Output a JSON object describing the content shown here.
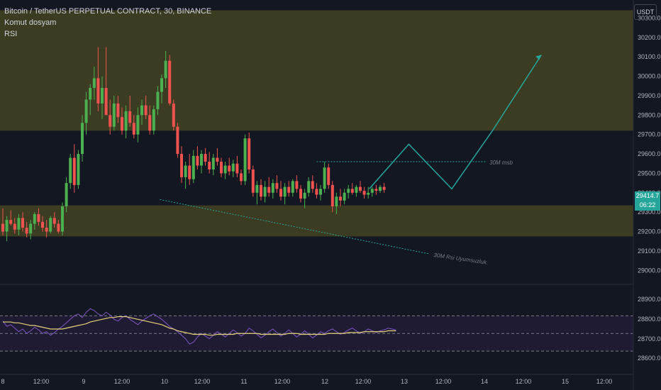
{
  "header": {
    "title": "Bitcoin / TetherUS PERPETUAL CONTRACT, 30, BINANCE",
    "indicator_1": "Komut dosyam",
    "indicator_2": "RSI",
    "currency": "USDT"
  },
  "last_price": {
    "price": "29414.7",
    "countdown": "06:22"
  },
  "annotations": {
    "msb_label": "30M msb",
    "divergence_label": "30M Rsi Uyumsuzluk."
  },
  "colors": {
    "up": "#4caf50",
    "down": "#ef5350",
    "zone_fill": "#3b3c22",
    "rsi_band": "#1e1b33",
    "rsi_line": "#7e57c2",
    "rsi_ma": "#e6d27a",
    "projection": "#26a69a",
    "price_badge": "#26a69a"
  },
  "chart_data": {
    "type": "candlestick",
    "price_axis": {
      "ticks": [
        "30300.0",
        "30200.0",
        "30100.0",
        "30000.0",
        "29900.0",
        "29800.0",
        "29700.0",
        "29600.0",
        "29500.0",
        "29400.0",
        "29300.0",
        "29200.0",
        "29100.0",
        "29000.0",
        "28900.0",
        "28800.0",
        "28700.0",
        "28600.0"
      ],
      "range": [
        28550,
        30340
      ]
    },
    "time_axis": {
      "ticks": [
        "8",
        "12:00",
        "9",
        "12:00",
        "10",
        "12:00",
        "11",
        "12:00",
        "12",
        "12:00",
        "13",
        "12:00",
        "14",
        "12:00",
        "15",
        "12:00"
      ]
    },
    "zones": [
      {
        "from": 29720,
        "to": 30340
      },
      {
        "from": 29175,
        "to": 29335
      }
    ],
    "candles": [
      [
        29240,
        29320,
        29180,
        29200
      ],
      [
        29200,
        29280,
        29150,
        29260
      ],
      [
        29260,
        29310,
        29230,
        29240
      ],
      [
        29240,
        29270,
        29190,
        29210
      ],
      [
        29210,
        29290,
        29180,
        29270
      ],
      [
        29270,
        29300,
        29200,
        29220
      ],
      [
        29220,
        29250,
        29170,
        29190
      ],
      [
        29190,
        29260,
        29160,
        29240
      ],
      [
        29240,
        29300,
        29210,
        29290
      ],
      [
        29290,
        29320,
        29230,
        29250
      ],
      [
        29250,
        29280,
        29200,
        29220
      ],
      [
        29220,
        29260,
        29170,
        29200
      ],
      [
        29200,
        29280,
        29190,
        29270
      ],
      [
        29270,
        29300,
        29220,
        29240
      ],
      [
        29240,
        29260,
        29190,
        29200
      ],
      [
        29200,
        29350,
        29180,
        29330
      ],
      [
        29330,
        29480,
        29300,
        29450
      ],
      [
        29450,
        29600,
        29420,
        29580
      ],
      [
        29580,
        29650,
        29400,
        29440
      ],
      [
        29440,
        29620,
        29420,
        29600
      ],
      [
        29600,
        29800,
        29560,
        29760
      ],
      [
        29760,
        29920,
        29700,
        29880
      ],
      [
        29880,
        29960,
        29800,
        29940
      ],
      [
        29940,
        30050,
        29880,
        29990
      ],
      [
        29990,
        30150,
        29820,
        29860
      ],
      [
        29860,
        30000,
        29780,
        29940
      ],
      [
        29940,
        30150,
        29850,
        29800
      ],
      [
        29800,
        29880,
        29700,
        29740
      ],
      [
        29740,
        29900,
        29720,
        29860
      ],
      [
        29860,
        29900,
        29760,
        29790
      ],
      [
        29790,
        29840,
        29700,
        29720
      ],
      [
        29720,
        29850,
        29680,
        29820
      ],
      [
        29820,
        29900,
        29740,
        29760
      ],
      [
        29760,
        29800,
        29680,
        29700
      ],
      [
        29700,
        29840,
        29660,
        29800
      ],
      [
        29800,
        29880,
        29750,
        29850
      ],
      [
        29850,
        29900,
        29780,
        29800
      ],
      [
        29800,
        29850,
        29700,
        29720
      ],
      [
        29720,
        29850,
        29700,
        29830
      ],
      [
        29830,
        29950,
        29800,
        29920
      ],
      [
        29920,
        30010,
        29860,
        29990
      ],
      [
        29990,
        30130,
        29940,
        30080
      ],
      [
        30080,
        30110,
        29850,
        29860
      ],
      [
        29860,
        29880,
        29720,
        29740
      ],
      [
        29740,
        29760,
        29580,
        29600
      ],
      [
        29600,
        29640,
        29450,
        29480
      ],
      [
        29480,
        29560,
        29420,
        29540
      ],
      [
        29540,
        29600,
        29440,
        29470
      ],
      [
        29470,
        29620,
        29450,
        29590
      ],
      [
        29590,
        29640,
        29520,
        29540
      ],
      [
        29540,
        29620,
        29500,
        29600
      ],
      [
        29600,
        29630,
        29540,
        29560
      ],
      [
        29560,
        29610,
        29500,
        29520
      ],
      [
        29520,
        29600,
        29490,
        29580
      ],
      [
        29580,
        29630,
        29540,
        29560
      ],
      [
        29560,
        29580,
        29480,
        29500
      ],
      [
        29500,
        29560,
        29470,
        29540
      ],
      [
        29540,
        29580,
        29490,
        29510
      ],
      [
        29510,
        29570,
        29480,
        29550
      ],
      [
        29550,
        29590,
        29480,
        29500
      ],
      [
        29500,
        29520,
        29440,
        29460
      ],
      [
        29460,
        29700,
        29440,
        29680
      ],
      [
        29680,
        29710,
        29500,
        29520
      ],
      [
        29520,
        29540,
        29380,
        29400
      ],
      [
        29400,
        29460,
        29340,
        29440
      ],
      [
        29440,
        29470,
        29360,
        29380
      ],
      [
        29380,
        29460,
        29350,
        29430
      ],
      [
        29430,
        29480,
        29380,
        29400
      ],
      [
        29400,
        29470,
        29370,
        29450
      ],
      [
        29450,
        29490,
        29400,
        29420
      ],
      [
        29420,
        29460,
        29360,
        29380
      ],
      [
        29380,
        29450,
        29340,
        29430
      ],
      [
        29430,
        29460,
        29380,
        29400
      ],
      [
        29400,
        29470,
        29380,
        29460
      ],
      [
        29460,
        29490,
        29400,
        29420
      ],
      [
        29420,
        29440,
        29350,
        29370
      ],
      [
        29370,
        29420,
        29320,
        29400
      ],
      [
        29400,
        29480,
        29380,
        29460
      ],
      [
        29460,
        29490,
        29400,
        29420
      ],
      [
        29420,
        29450,
        29370,
        29390
      ],
      [
        29390,
        29440,
        29360,
        29420
      ],
      [
        29420,
        29560,
        29400,
        29530
      ],
      [
        29530,
        29550,
        29420,
        29440
      ],
      [
        29440,
        29460,
        29300,
        29330
      ],
      [
        29330,
        29400,
        29290,
        29380
      ],
      [
        29380,
        29420,
        29330,
        29360
      ],
      [
        29360,
        29420,
        29340,
        29400
      ],
      [
        29400,
        29440,
        29370,
        29420
      ],
      [
        29420,
        29450,
        29390,
        29400
      ],
      [
        29400,
        29440,
        29380,
        29430
      ],
      [
        29430,
        29460,
        29400,
        29410
      ],
      [
        29410,
        29430,
        29370,
        29390
      ],
      [
        29390,
        29430,
        29370,
        29400
      ],
      [
        29400,
        29430,
        29380,
        29420
      ],
      [
        29420,
        29440,
        29390,
        29410
      ],
      [
        29410,
        29440,
        29400,
        29430
      ],
      [
        29430,
        29450,
        29400,
        29415
      ]
    ],
    "msb_level": 29560,
    "projection": {
      "x": [
        31.5,
        34.9,
        38.6,
        42.1,
        46.3
      ],
      "y": [
        29420,
        29650,
        29420,
        29720,
        30110
      ]
    },
    "divergence_line": {
      "x": [
        19.6,
        53.2
      ],
      "y": [
        29365,
        29085
      ]
    },
    "rsi": {
      "axis": {
        "ticks": [
          "28900.0",
          "28800.0",
          "28700.0",
          "28600.0"
        ],
        "range": [
          28540,
          28980
        ]
      },
      "levels": [
        70,
        50,
        30
      ],
      "values": [
        64,
        58,
        60,
        56,
        52,
        55,
        50,
        53,
        57,
        54,
        50,
        52,
        48,
        51,
        55,
        58,
        62,
        66,
        70,
        72,
        68,
        74,
        78,
        76,
        72,
        70,
        74,
        71,
        66,
        64,
        68,
        70,
        66,
        63,
        60,
        64,
        67,
        70,
        72,
        69,
        66,
        62,
        58,
        55,
        52,
        48,
        44,
        38,
        40,
        46,
        50,
        47,
        44,
        48,
        52,
        49,
        46,
        50,
        54,
        51,
        47,
        50,
        56,
        53,
        49,
        45,
        48,
        52,
        55,
        51,
        47,
        50,
        54,
        50,
        46,
        49,
        53,
        49,
        45,
        48,
        52,
        50,
        53,
        55,
        52,
        49,
        51,
        54,
        56,
        53,
        50,
        52,
        55,
        53,
        51,
        53,
        54,
        56,
        55,
        54
      ],
      "ma": [
        63,
        63,
        63,
        62,
        62,
        61,
        60,
        59,
        59,
        58,
        57,
        56,
        55,
        55,
        55,
        55,
        56,
        57,
        58,
        59,
        60,
        61,
        63,
        64,
        65,
        66,
        67,
        68,
        68,
        69,
        69,
        69,
        68,
        67,
        66,
        65,
        64,
        63,
        62,
        61,
        60,
        58,
        56,
        55,
        53,
        52,
        51,
        50,
        49,
        49,
        49,
        49,
        48,
        48,
        49,
        49,
        49,
        49,
        49,
        50,
        50,
        50,
        50,
        50,
        50,
        49,
        49,
        49,
        49,
        49,
        49,
        49,
        50,
        50,
        50,
        49,
        49,
        49,
        49,
        49,
        49,
        49,
        50,
        50,
        50,
        50,
        50,
        51,
        51,
        51,
        51,
        52,
        52,
        52,
        52,
        52,
        52,
        53,
        53,
        53
      ]
    }
  }
}
